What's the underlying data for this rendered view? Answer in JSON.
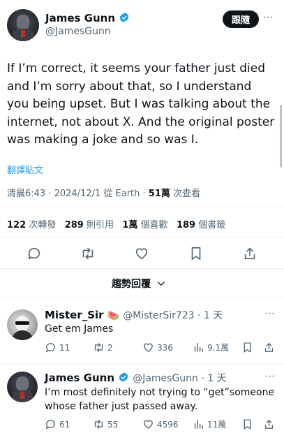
{
  "main_tweet": {
    "author_name": "James Gunn",
    "author_handle": "@JamesGunn",
    "follow_label": "跟隨",
    "text": "If I’m correct, it seems your father just died and I’m sorry about that, so I understand you being upset. But I was talking about the internet, not about X. And the original poster was making a joke and so was I.",
    "translate_label": "翻譯貼文",
    "timestamp": "清晨6:43 · 2024/12/1 從 Earth · ",
    "views_count": "51萬",
    "views_label": " 次查看",
    "stats": {
      "retweets_count": "122",
      "retweets_label": " 次轉發",
      "quotes_count": "289",
      "quotes_label": " 則引用",
      "likes_count": "1萬",
      "likes_label": " 個喜歡",
      "bookmarks_count": "189",
      "bookmarks_label": " 個書籤"
    }
  },
  "sort": {
    "label": "趨勢回覆"
  },
  "replies": [
    {
      "author_name": "Mister_Sir",
      "emoji": "🍉",
      "meta": "@MisterSir723 · 1 天",
      "text": "Get em James",
      "reply_count": "11",
      "retweet_count": "2",
      "like_count": "336",
      "view_count": "9.1萬"
    },
    {
      "author_name": "James Gunn",
      "meta": "@JamesGunn · 1 天",
      "text": "I’m most definitely not trying to “get”someone whose father just passed away.",
      "reply_count": "61",
      "retweet_count": "55",
      "like_count": "4596",
      "view_count": "11萬"
    }
  ],
  "colors": {
    "accent": "#1d9bf0",
    "text": "#0f1419",
    "muted": "#536471",
    "divider": "#eff3f4"
  }
}
